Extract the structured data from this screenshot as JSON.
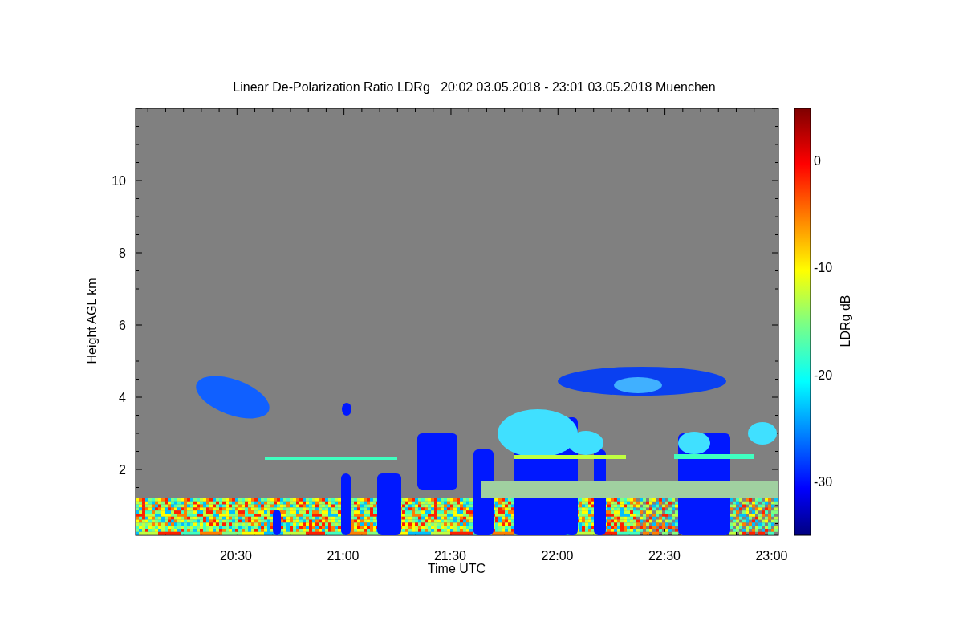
{
  "title": "Linear De-Polarization Ratio LDRg   20:02 03.05.2018 - 23:01 03.05.2018 Muenchen",
  "y_axis": {
    "label": "Height AGL km",
    "tick_labels": [
      "10",
      "8",
      "6",
      "4",
      "2"
    ]
  },
  "x_axis": {
    "label": "Time UTC",
    "tick_labels": [
      "20:30",
      "21:00",
      "21:30",
      "22:00",
      "22:30",
      "23:00"
    ]
  },
  "colorbar": {
    "label": "LDRg dB",
    "tick_labels": [
      "0",
      "-10",
      "-20",
      "-30"
    ]
  }
}
